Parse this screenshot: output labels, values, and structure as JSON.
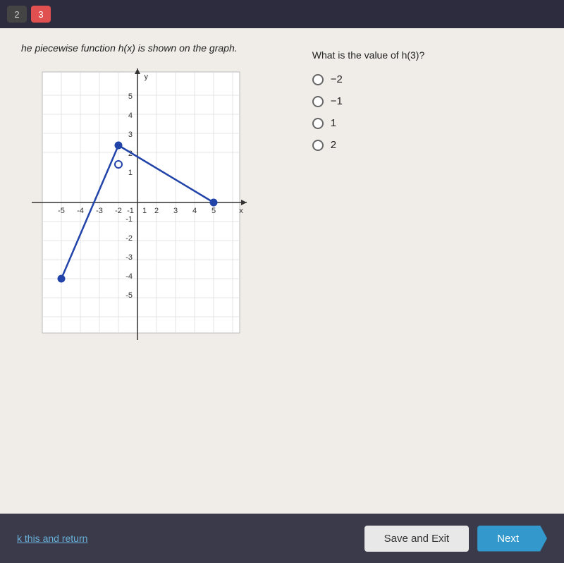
{
  "topbar": {
    "tab1": "2",
    "tab2": "3"
  },
  "question": {
    "left_text": "he piecewise function h(x) is shown on the graph.",
    "right_text": "What is the value of h(3)?",
    "options": [
      {
        "label": "−2",
        "value": "-2"
      },
      {
        "label": "−1",
        "value": "-1"
      },
      {
        "label": "1",
        "value": "1"
      },
      {
        "label": "2",
        "value": "2"
      }
    ]
  },
  "footer": {
    "skip_link": "k this and return",
    "save_exit": "Save and Exit",
    "next": "Next"
  }
}
